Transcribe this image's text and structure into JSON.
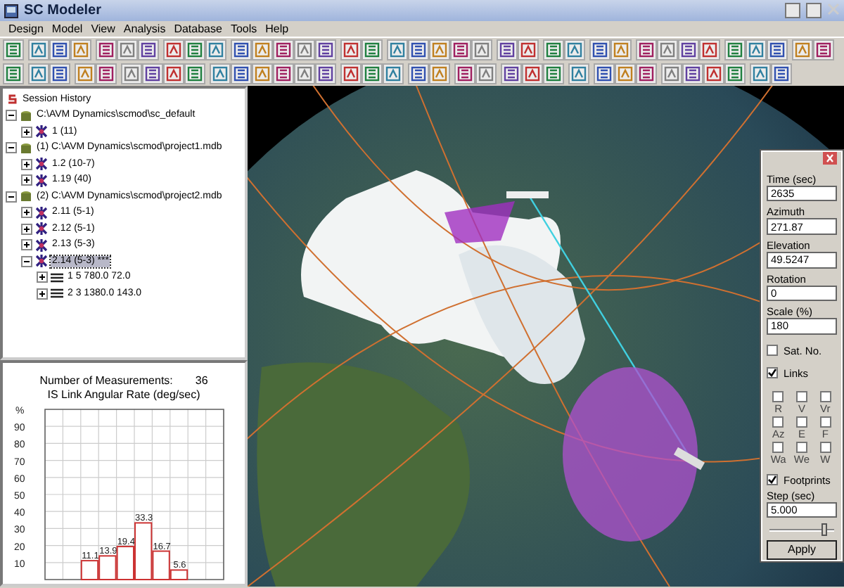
{
  "window": {
    "title": "SC Modeler"
  },
  "menu": [
    "Design",
    "Model",
    "View",
    "Analysis",
    "Database",
    "Tools",
    "Help"
  ],
  "session_tree": {
    "label": "Session History",
    "kind": "session",
    "selected": false,
    "children": [
      {
        "label": "C:\\AVM Dynamics\\scmod\\sc_default",
        "kind": "database",
        "expanded": true,
        "selected": false,
        "children": [
          {
            "label": "1 (11)",
            "kind": "satellite",
            "expanded": false,
            "selected": false
          }
        ]
      },
      {
        "label": "(1) C:\\AVM Dynamics\\scmod\\project1.mdb",
        "kind": "database",
        "expanded": true,
        "selected": false,
        "children": [
          {
            "label": "1.2 (10-7)",
            "kind": "satellite",
            "expanded": false,
            "selected": false
          },
          {
            "label": "1.19 (40)",
            "kind": "satellite",
            "expanded": false,
            "selected": false
          }
        ]
      },
      {
        "label": "(2) C:\\AVM Dynamics\\scmod\\project2.mdb",
        "kind": "database",
        "expanded": true,
        "selected": false,
        "children": [
          {
            "label": "2.11 (5-1)",
            "kind": "satellite",
            "expanded": false,
            "selected": false
          },
          {
            "label": "2.12 (5-1)",
            "kind": "satellite",
            "expanded": false,
            "selected": false
          },
          {
            "label": "2.13 (5-3)",
            "kind": "satellite",
            "expanded": false,
            "selected": false
          },
          {
            "label": "2.14 (5-3) ***",
            "kind": "satellite",
            "expanded": true,
            "selected": true,
            "children": [
              {
                "label": "1 5 780.0 72.0",
                "kind": "link",
                "expanded": false,
                "selected": false
              },
              {
                "label": "2 3 1380.0 143.0",
                "kind": "link",
                "expanded": false,
                "selected": false
              }
            ]
          }
        ]
      }
    ]
  },
  "histogram": {
    "measurements_label": "Number of Measurements:",
    "measurements": "36",
    "chart_data": {
      "type": "bar",
      "title": "IS Link Angular Rate (deg/sec)",
      "ylabel": "%",
      "ylim": [
        0,
        100
      ],
      "yticks": [
        10,
        20,
        30,
        40,
        50,
        60,
        70,
        80,
        90
      ],
      "data_labels": true,
      "grid": true,
      "series": [
        {
          "color": "#cc3333",
          "values": [
            null,
            null,
            11.1,
            13.9,
            19.4,
            33.3,
            16.7,
            5.6,
            null,
            null
          ]
        }
      ]
    }
  },
  "view_panel": {
    "fields": [
      {
        "label": "Time (sec)",
        "value": "2635"
      },
      {
        "label": "Azimuth",
        "value": "271.87"
      },
      {
        "label": "Elevation",
        "value": "49.5247"
      },
      {
        "label": "Rotation",
        "value": "0"
      },
      {
        "label": "Scale (%)",
        "value": "180"
      }
    ],
    "checks": [
      {
        "label": "Sat. No.",
        "checked": false
      },
      {
        "label": "Links",
        "checked": true
      }
    ],
    "link_options": [
      {
        "label": "R",
        "checked": false
      },
      {
        "label": "V",
        "checked": false
      },
      {
        "label": "Vr",
        "checked": false
      },
      {
        "label": "Az",
        "checked": false
      },
      {
        "label": "E",
        "checked": false
      },
      {
        "label": "F",
        "checked": false
      },
      {
        "label": "Wa",
        "checked": false
      },
      {
        "label": "We",
        "checked": false
      },
      {
        "label": "W",
        "checked": false
      }
    ],
    "footprints": {
      "label": "Footprints",
      "checked": true
    },
    "step": {
      "label": "Step (sec)",
      "value": "5.000"
    },
    "slider": {
      "level": 0.85
    },
    "apply": "Apply"
  }
}
